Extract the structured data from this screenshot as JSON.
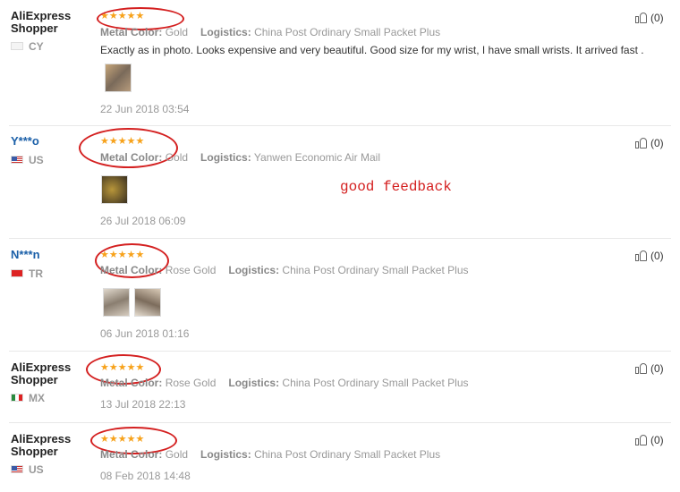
{
  "reviews": [
    {
      "user": "AliExpress Shopper",
      "country": "CY",
      "stars": "★★★★★",
      "metal_label": "Metal Color:",
      "metal_value": "Gold",
      "logistics_label": "Logistics:",
      "logistics_value": "China Post Ordinary Small Packet Plus",
      "text": "Exactly as in photo. Looks expensive and very beautiful. Good size for my wrist, I have small wrists. It arrived fast .",
      "date": "22 Jun 2018 03:54",
      "helpful": "(0)"
    },
    {
      "user": "Y***o",
      "country": "US",
      "stars": "★★★★★",
      "metal_label": "Metal Color:",
      "metal_value": "Gold",
      "logistics_label": "Logistics:",
      "logistics_value": "Yanwen Economic Air Mail",
      "date": "26 Jul 2018 06:09",
      "helpful": "(0)"
    },
    {
      "user": "N***n",
      "country": "TR",
      "stars": "★★★★★",
      "metal_label": "Metal Color:",
      "metal_value": "Rose Gold",
      "logistics_label": "Logistics:",
      "logistics_value": "China Post Ordinary Small Packet Plus",
      "date": "06 Jun 2018 01:16",
      "helpful": "(0)"
    },
    {
      "user": "AliExpress Shopper",
      "country": "MX",
      "stars": "★★★★★",
      "metal_label": "Metal Color:",
      "metal_value": "Rose Gold",
      "logistics_label": "Logistics:",
      "logistics_value": "China Post Ordinary Small Packet Plus",
      "date": "13 Jul 2018 22:13",
      "helpful": "(0)"
    },
    {
      "user": "AliExpress Shopper",
      "country": "US",
      "stars": "★★★★★",
      "metal_label": "Metal Color:",
      "metal_value": "Gold",
      "logistics_label": "Logistics:",
      "logistics_value": "China Post Ordinary Small Packet Plus",
      "date": "08 Feb 2018 14:48",
      "helpful": "(0)"
    }
  ],
  "annotation": "good feedback",
  "colors": {
    "star": "#f7a21b",
    "annotation": "#d42020",
    "username_link": "#1a5fa8"
  }
}
